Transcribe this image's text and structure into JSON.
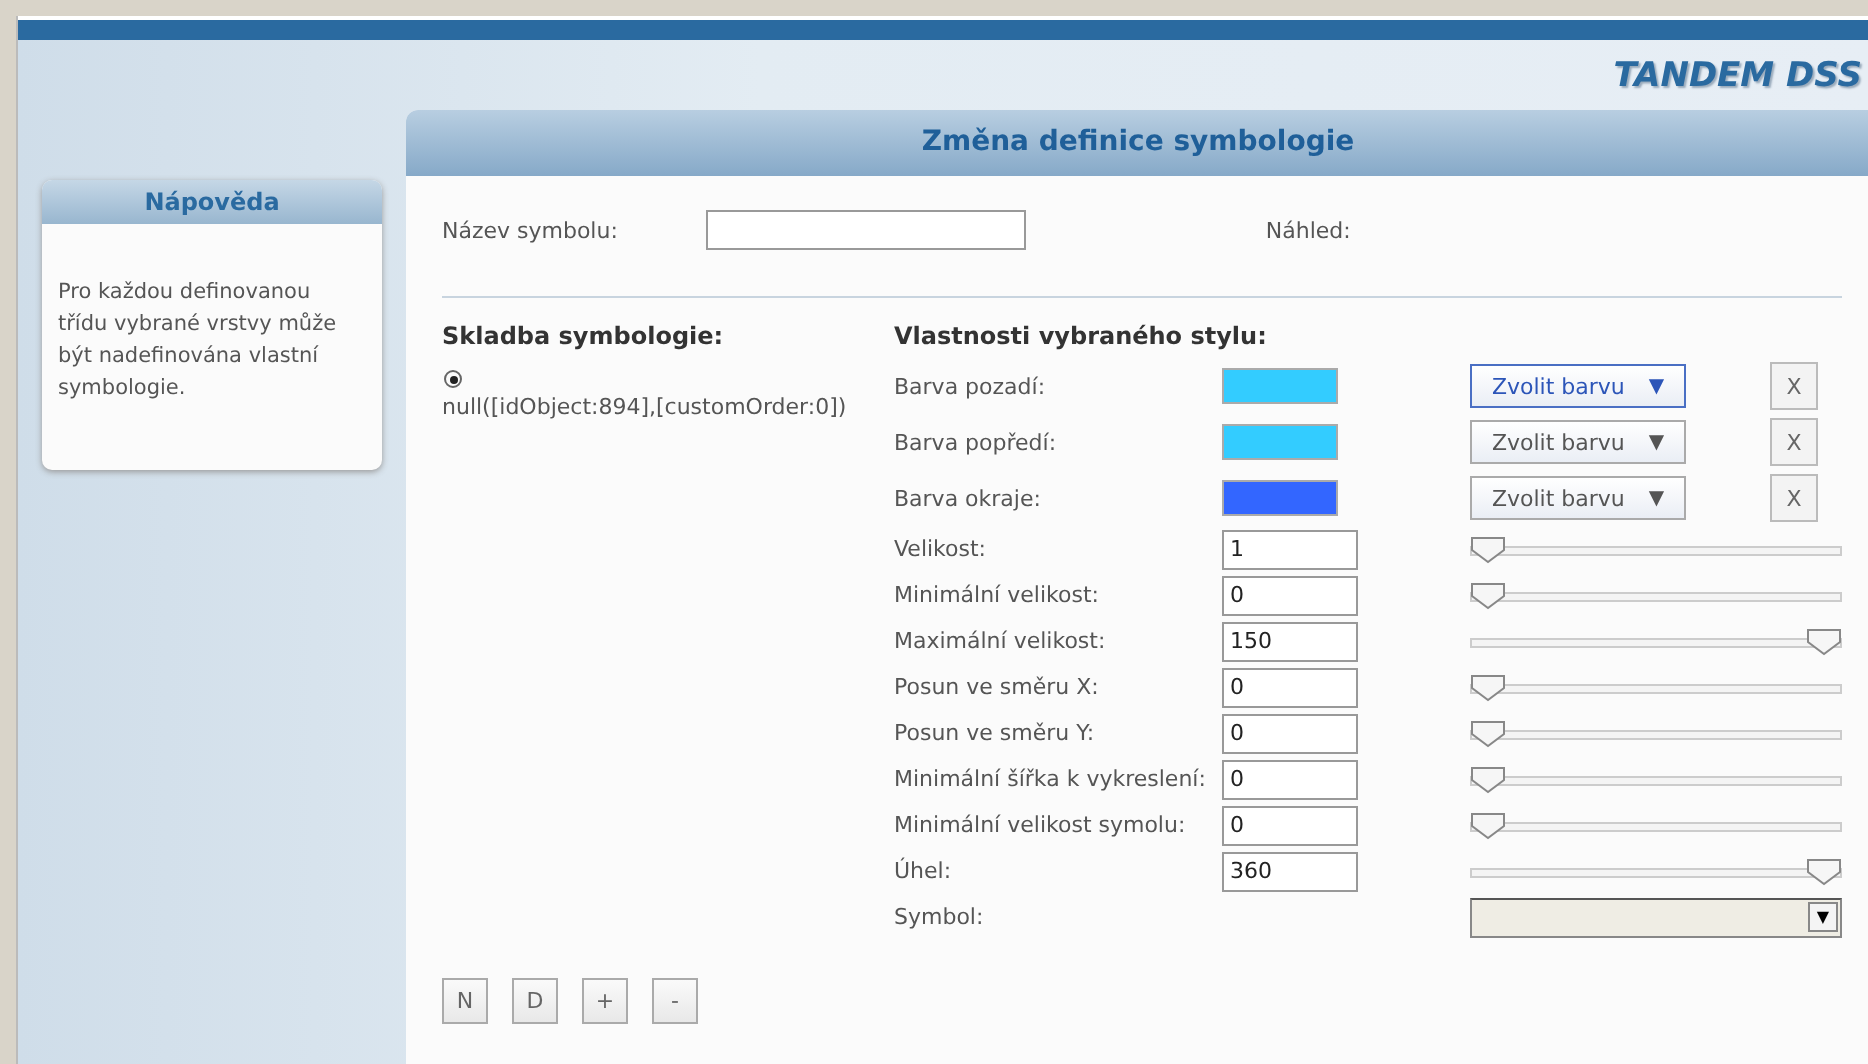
{
  "brand": "TANDEM DSS",
  "help": {
    "title": "Nápověda",
    "text": "Pro každou definovanou třídu vybrané vrstvy může být nadefinována vlastní symbologie."
  },
  "dialog": {
    "title": "Změna definice symbologie",
    "name_label": "Název symbolu:",
    "preview_label": "Náhled:",
    "composition": {
      "title": "Skladba symbologie:",
      "items": [
        {
          "label": "null([idObject:894],[customOrder:0])",
          "selected": true
        }
      ]
    },
    "style": {
      "title": "Vlastnosti vybraného stylu:",
      "rows": [
        {
          "kind": "color",
          "label": "Barva pozadí:",
          "color": "#33ccff",
          "button": "Zvolit barvu",
          "arrow": "▼",
          "focused": true,
          "clear": "X"
        },
        {
          "kind": "color",
          "label": "Barva popředí:",
          "color": "#33ccff",
          "button": "Zvolit barvu",
          "arrow": "▼",
          "focused": false,
          "clear": "X"
        },
        {
          "kind": "color",
          "label": "Barva okraje:",
          "color": "#3366ff",
          "button": "Zvolit barvu",
          "arrow": "▼",
          "focused": false,
          "clear": "X"
        },
        {
          "kind": "number",
          "label": "Velikost:",
          "value": "1",
          "level": 0
        },
        {
          "kind": "number",
          "label": "Minimální velikost:",
          "value": "0",
          "level": 0
        },
        {
          "kind": "number",
          "label": "Maximální velikost:",
          "value": "150",
          "level": 1
        },
        {
          "kind": "number",
          "label": "Posun ve směru X:",
          "value": "0",
          "level": 0
        },
        {
          "kind": "number",
          "label": "Posun ve směru Y:",
          "value": "0",
          "level": 0
        },
        {
          "kind": "number",
          "label": "Minimální šířka k vykreslení:",
          "value": "0",
          "level": 0
        },
        {
          "kind": "number",
          "label": "Minimální velikost symolu:",
          "value": "0",
          "level": 0
        },
        {
          "kind": "number",
          "label": "Úhel:",
          "value": "360",
          "level": 1
        },
        {
          "kind": "select",
          "label": "Symbol:",
          "arrow": "▼"
        }
      ]
    },
    "buttons": [
      "N",
      "D",
      "+",
      "-"
    ]
  }
}
